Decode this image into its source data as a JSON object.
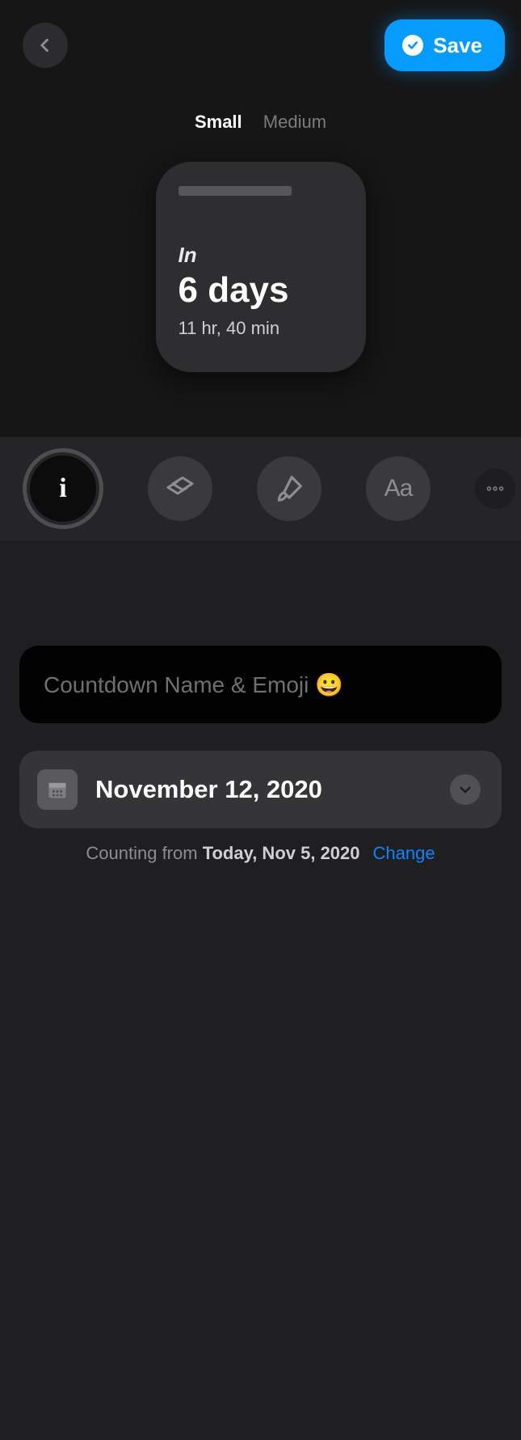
{
  "header": {
    "save_label": "Save"
  },
  "size_tabs": {
    "small": "Small",
    "medium": "Medium"
  },
  "widget": {
    "prefix": "In",
    "main": "6 days",
    "sub": "11 hr, 40 min"
  },
  "toolbar": {
    "info_glyph": "i",
    "font_glyph": "Aa"
  },
  "name_input": {
    "placeholder": "Countdown Name & Emoji 😀"
  },
  "date_row": {
    "value": "November 12, 2020"
  },
  "counting": {
    "prefix": "Counting from ",
    "today_label": "Today, Nov 5, 2020",
    "change_label": "Change"
  }
}
